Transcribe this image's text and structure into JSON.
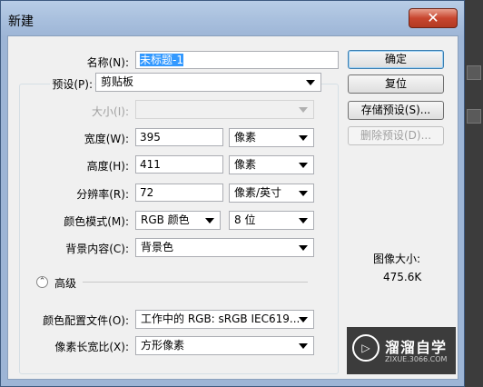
{
  "window": {
    "title": "新建",
    "close_glyph": "✕"
  },
  "form": {
    "name": {
      "label": "名称(N):",
      "value": "未标题-1"
    },
    "preset": {
      "label": "预设(P):",
      "value": "剪贴板"
    },
    "size": {
      "label": "大小(I):",
      "value": ""
    },
    "width": {
      "label": "宽度(W):",
      "value": "395",
      "unit": "像素"
    },
    "height": {
      "label": "高度(H):",
      "value": "411",
      "unit": "像素"
    },
    "resolution": {
      "label": "分辨率(R):",
      "value": "72",
      "unit": "像素/英寸"
    },
    "color_mode": {
      "label": "颜色模式(M):",
      "mode": "RGB 颜色",
      "depth": "8 位"
    },
    "background": {
      "label": "背景内容(C):",
      "value": "背景色"
    },
    "advanced": {
      "label": "高级",
      "icon": "chevron-up-icon"
    },
    "color_profile": {
      "label": "颜色配置文件(O):",
      "value": "工作中的 RGB: sRGB IEC619..."
    },
    "pixel_aspect": {
      "label": "像素长宽比(X):",
      "value": "方形像素"
    }
  },
  "buttons": {
    "ok": "确定",
    "reset": "复位",
    "save_preset": "存储预设(S)...",
    "delete_preset": "删除预设(D)..."
  },
  "image_size": {
    "label": "图像大小:",
    "value": "475.6K"
  },
  "watermark": {
    "text": "溜溜自学",
    "url": "ZIXUE.3066.COM",
    "logo_glyph": "▷"
  },
  "colors": {
    "title_bar": "#a9c0de",
    "close_button": "#c8462f",
    "selection": "#3399ff"
  }
}
